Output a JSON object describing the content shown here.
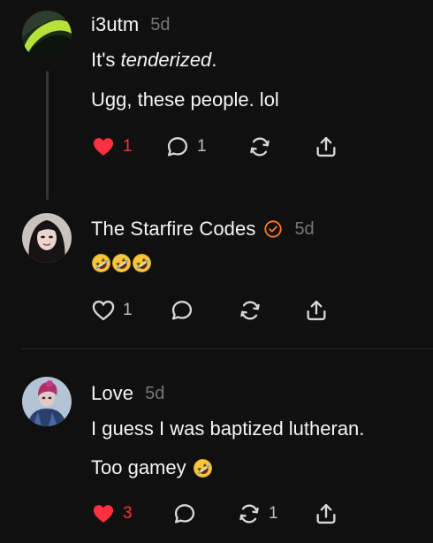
{
  "comments": [
    {
      "username": "i3utm",
      "time": "5d",
      "line1_prefix": "It's ",
      "line1_emphasis": "tenderized",
      "line1_suffix": ".",
      "line2": "Ugg, these people. lol",
      "likes": "1",
      "replies": "1",
      "liked": true
    },
    {
      "username": "The Starfire Codes",
      "time": "5d",
      "verified": true,
      "body_emojis": [
        "rolling-on-floor-laughing-emoji",
        "rolling-on-floor-laughing-emoji",
        "rolling-on-floor-laughing-emoji"
      ],
      "likes": "1",
      "liked": false
    },
    {
      "username": "Love",
      "time": "5d",
      "line1": "I guess I was baptized lutheran.",
      "line2": "Too gamey",
      "line2_emoji": "rolling-on-floor-laughing-emoji",
      "likes": "3",
      "reposts": "1",
      "liked": true
    }
  ],
  "colors": {
    "background": "#101010",
    "text": "#f3f5f7",
    "muted": "#777777",
    "like_red": "#ff3040",
    "verified_orange": "#ff7a1a"
  },
  "icons": {
    "like": "heart-icon",
    "reply": "speech-bubble-icon",
    "repost": "repost-arrows-icon",
    "share": "share-upload-icon"
  }
}
